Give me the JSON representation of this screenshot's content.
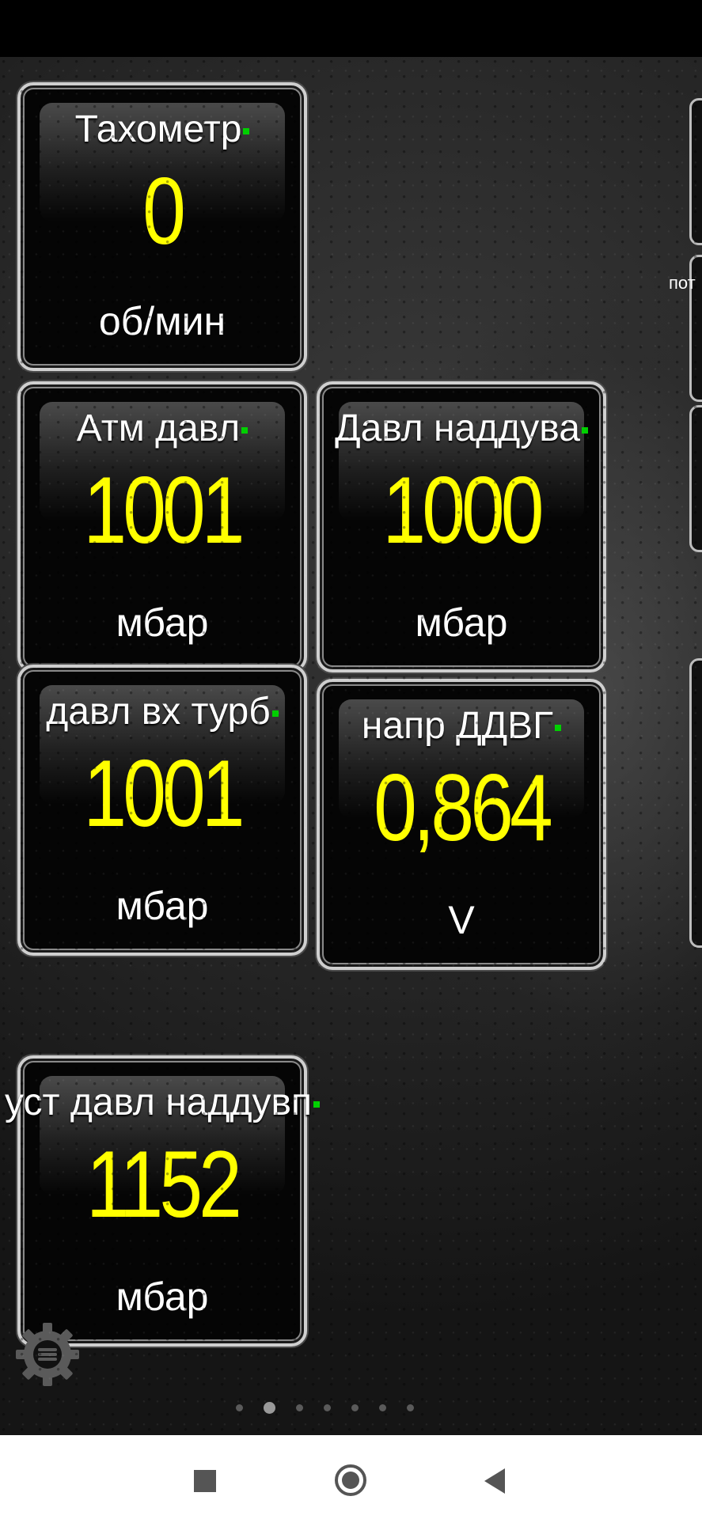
{
  "gauges": [
    {
      "title": "Тахометр",
      "value": "0",
      "unit": "об/мин"
    },
    {
      "title": "Атм давл",
      "value": "1001",
      "unit": "мбар"
    },
    {
      "title": "Давл наддува",
      "value": "1000",
      "unit": "мбар"
    },
    {
      "title": "давл вх турб",
      "value": "1001",
      "unit": "мбар"
    },
    {
      "title": "напр ДДВГ",
      "value": "0,864",
      "unit": "V"
    },
    {
      "title": "уст давл наддувп",
      "value": "1152",
      "unit": "мбар"
    }
  ],
  "edge_label": "пот",
  "pager": {
    "pages": 7,
    "active": 2
  },
  "colors": {
    "value": "#ffff00",
    "indicator": "#00d000",
    "frame": "#cfcfcf"
  },
  "icons": {
    "settings": "gear-icon",
    "nav_recents": "square-icon",
    "nav_home": "circle-icon",
    "nav_back": "triangle-back-icon"
  }
}
